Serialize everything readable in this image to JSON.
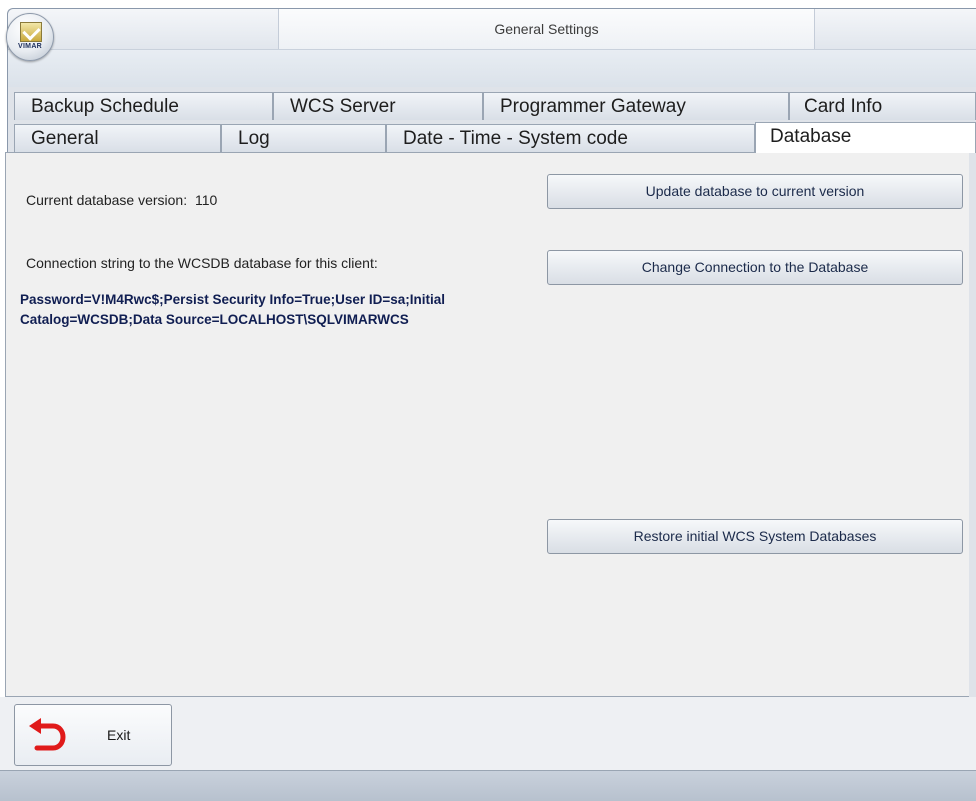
{
  "window": {
    "title": "General Settings"
  },
  "logo": {
    "text": "VIMAR"
  },
  "tabs": {
    "back_row": [
      {
        "label": "Backup Schedule"
      },
      {
        "label": "WCS Server"
      },
      {
        "label": "Programmer Gateway"
      },
      {
        "label": "Card Info"
      }
    ],
    "front_row": [
      {
        "label": "General"
      },
      {
        "label": "Log"
      },
      {
        "label": "Date - Time - System code"
      },
      {
        "label": "Database",
        "active": true
      }
    ]
  },
  "database": {
    "version_label": "Current database version:",
    "version_value": "110",
    "connection_label": "Connection string to the WCSDB database for this client:",
    "connection_string": "Password=V!M4Rwc$;Persist Security Info=True;User ID=sa;Initial Catalog=WCSDB;Data Source=LOCALHOST\\SQLVIMARWCS",
    "buttons": {
      "update": "Update database to current version",
      "change": "Change Connection to the Database",
      "restore": "Restore initial WCS System Databases"
    }
  },
  "footer": {
    "exit_label": "Exit",
    "exit_icon": "undo-arrow-icon",
    "exit_icon_color": "#e01a1a"
  },
  "colors": {
    "connection_text": "#101e52",
    "panel_bg": "#f0f0f0"
  }
}
